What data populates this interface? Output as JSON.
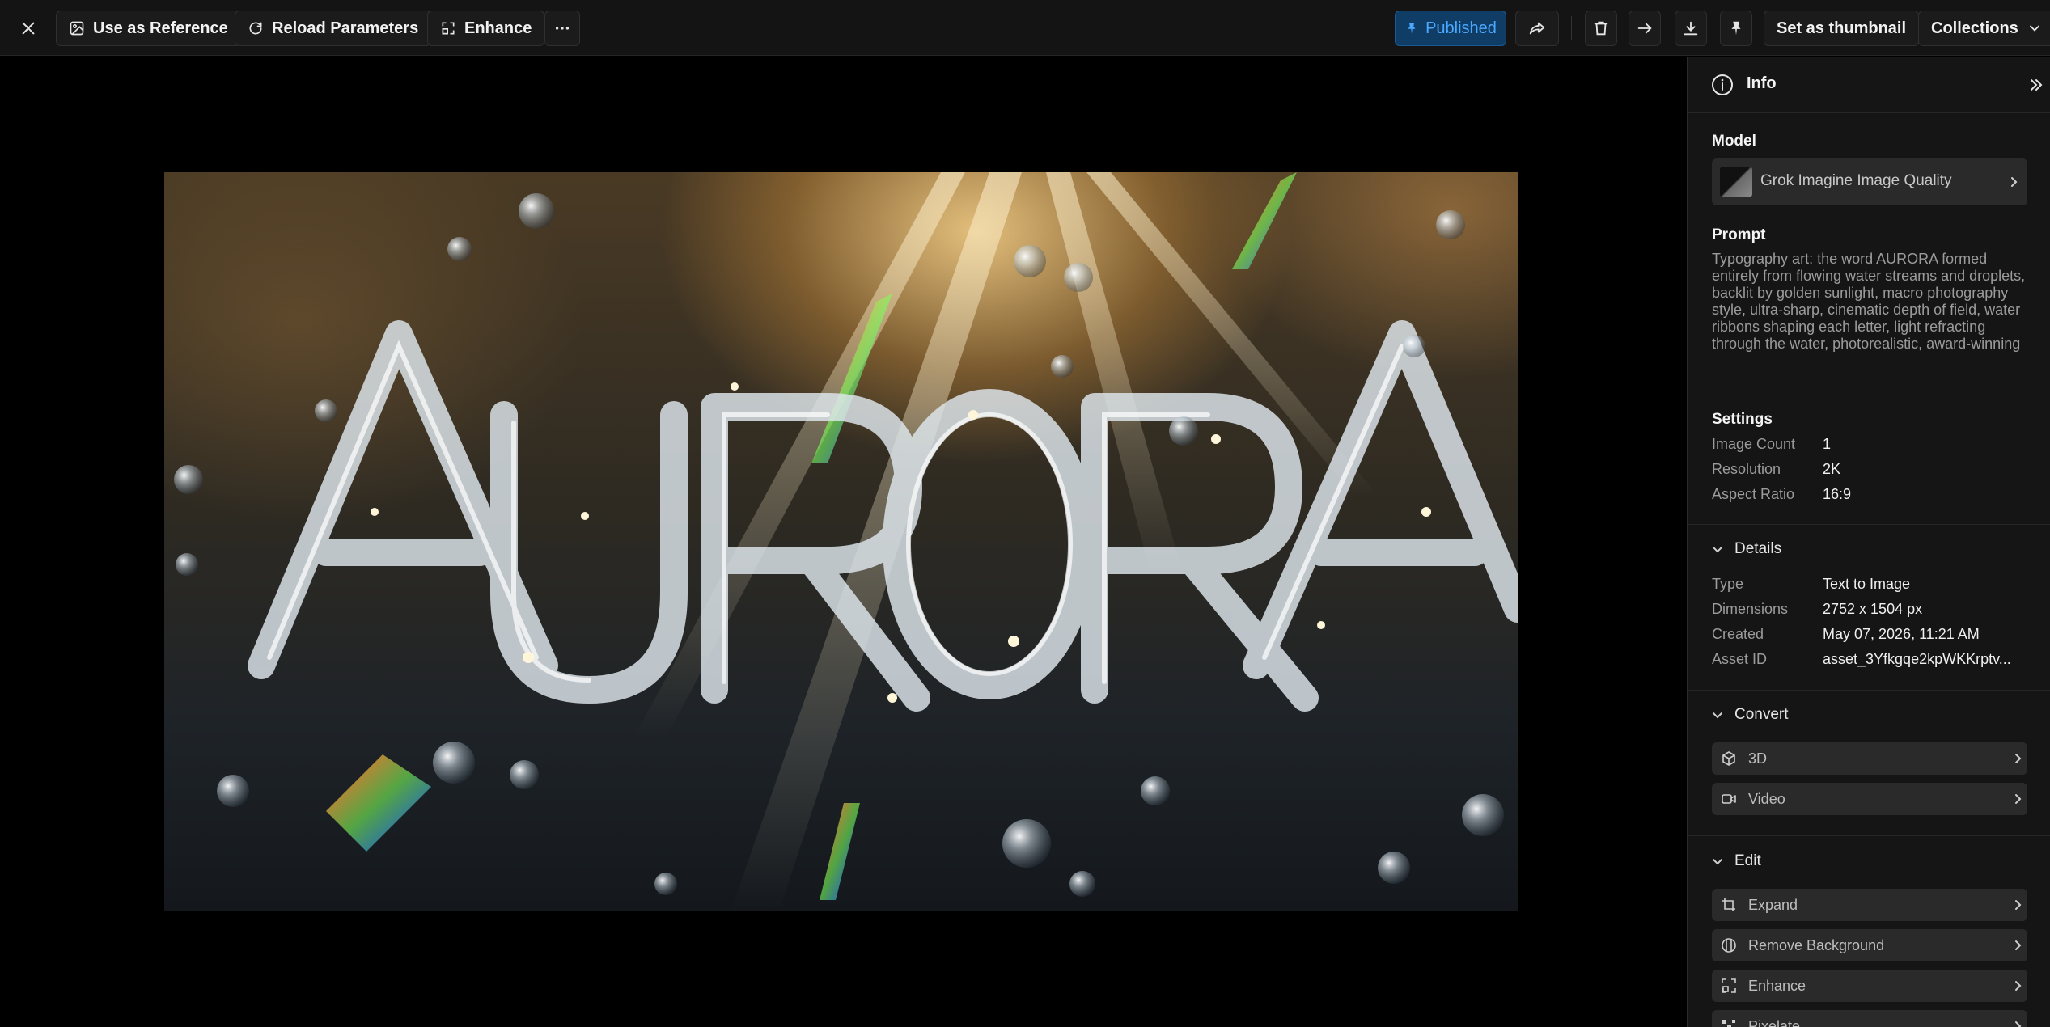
{
  "toolbar": {
    "use_as_reference": "Use as Reference",
    "reload_parameters": "Reload Parameters",
    "enhance": "Enhance",
    "published": "Published",
    "set_as_thumbnail": "Set as thumbnail",
    "collections": "Collections"
  },
  "image": {
    "word": "AURORA"
  },
  "panel": {
    "title": "Info",
    "model_label": "Model",
    "model_name": "Grok Imagine Image Quality",
    "prompt_label": "Prompt",
    "prompt_text": "Typography art: the word AURORA formed entirely from flowing water streams and droplets, backlit by golden sunlight, macro photography style, ultra-sharp, cinematic depth of field, water ribbons shaping each letter, light refracting through the water, photorealistic, award-winning",
    "settings_label": "Settings",
    "settings": [
      {
        "key": "Image Count",
        "value": "1"
      },
      {
        "key": "Resolution",
        "value": "2K"
      },
      {
        "key": "Aspect Ratio",
        "value": "16:9"
      }
    ],
    "details_label": "Details",
    "details": [
      {
        "key": "Type",
        "value": "Text to Image"
      },
      {
        "key": "Dimensions",
        "value": "2752 x 1504 px"
      },
      {
        "key": "Created",
        "value": "May 07, 2026, 11:21 AM"
      },
      {
        "key": "Asset ID",
        "value": "asset_3Yfkgqe2kpWKKrptv..."
      }
    ],
    "convert_label": "Convert",
    "convert_items": [
      "3D",
      "Video"
    ],
    "edit_label": "Edit",
    "edit_items": [
      "Expand",
      "Remove Background",
      "Enhance",
      "Pixelate"
    ]
  },
  "colors": {
    "accent": "#4aa8ff",
    "published_bg": "#0f3d66",
    "panel_bg": "#151515",
    "toolbar_bg": "#141414"
  }
}
